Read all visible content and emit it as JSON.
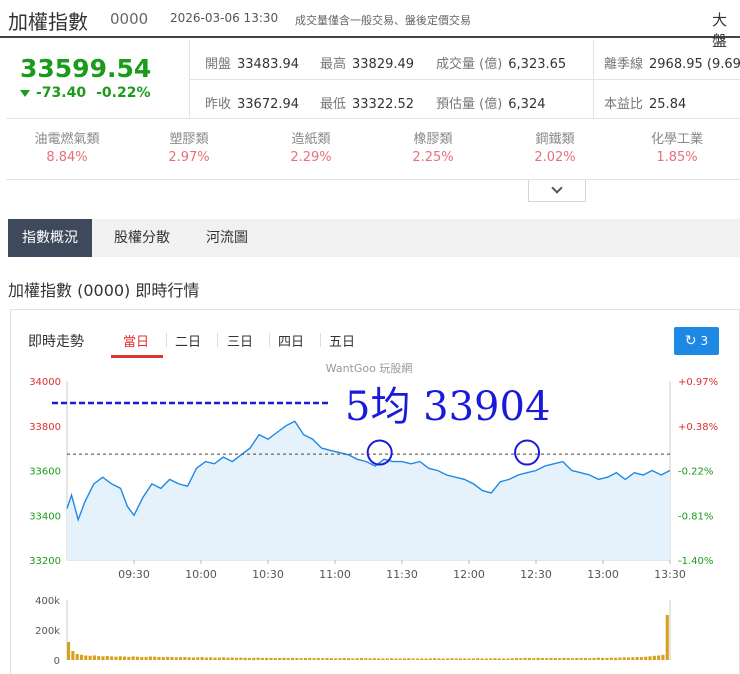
{
  "header": {
    "title": "加權指數",
    "code": "0000",
    "datetime": "2026-03-06 13:30",
    "note": "成交量僅含一般交易、盤後定價交易",
    "market": "大盤"
  },
  "quote": {
    "price": "33599.54",
    "change": "-73.40",
    "change_pct": "-0.22%",
    "stats": [
      {
        "label": "開盤",
        "value": "33483.94"
      },
      {
        "label": "最高",
        "value": "33829.49"
      },
      {
        "label": "成交量 (億)",
        "value": "6,323.65"
      },
      {
        "label": "離季線",
        "value": "2968.95 (9.69"
      },
      {
        "label": "昨收",
        "value": "33672.94"
      },
      {
        "label": "最低",
        "value": "33322.52"
      },
      {
        "label": "預估量 (億)",
        "value": "6,324"
      },
      {
        "label": "本益比",
        "value": "25.84"
      }
    ]
  },
  "sectors": [
    {
      "name": "油電燃氣類",
      "pct": "8.84%"
    },
    {
      "name": "塑膠類",
      "pct": "2.97%"
    },
    {
      "name": "造紙類",
      "pct": "2.29%"
    },
    {
      "name": "橡膠類",
      "pct": "2.25%"
    },
    {
      "name": "鋼鐵類",
      "pct": "2.02%"
    },
    {
      "name": "化學工業",
      "pct": "1.85%"
    }
  ],
  "nav": {
    "tabs": [
      "指數概況",
      "股權分散",
      "河流圖"
    ],
    "active": 0
  },
  "section_title": "加權指數 (0000) 即時行情",
  "chart_panel": {
    "title": "即時走勢",
    "tabs": [
      "當日",
      "二日",
      "三日",
      "四日",
      "五日"
    ],
    "active_tab": 0,
    "refresh_label": "3",
    "refresh_icon": "refresh-icon",
    "watermark": "WantGoo 玩股網",
    "annotation": "5均 33904"
  },
  "chart_data": {
    "type": "area",
    "prev_close": 33672.94,
    "ylim": [
      33200,
      34000
    ],
    "left_ticks": [
      "34000",
      "33800",
      "33600",
      "33400",
      "33200"
    ],
    "right_ticks": [
      "+0.97%",
      "+0.38%",
      "-0.22%",
      "-0.81%",
      "-1.40%"
    ],
    "x_ticks": [
      "09:30",
      "10:00",
      "10:30",
      "11:00",
      "11:30",
      "12:00",
      "12:30",
      "13:00",
      "13:30"
    ],
    "x_range_minutes": [
      0,
      270
    ],
    "price_points": [
      [
        0,
        33430
      ],
      [
        2,
        33490
      ],
      [
        5,
        33380
      ],
      [
        8,
        33460
      ],
      [
        12,
        33540
      ],
      [
        16,
        33570
      ],
      [
        20,
        33540
      ],
      [
        24,
        33520
      ],
      [
        27,
        33440
      ],
      [
        30,
        33400
      ],
      [
        34,
        33480
      ],
      [
        38,
        33540
      ],
      [
        42,
        33520
      ],
      [
        46,
        33560
      ],
      [
        50,
        33540
      ],
      [
        54,
        33530
      ],
      [
        58,
        33610
      ],
      [
        62,
        33640
      ],
      [
        66,
        33630
      ],
      [
        70,
        33660
      ],
      [
        74,
        33640
      ],
      [
        78,
        33670
      ],
      [
        82,
        33700
      ],
      [
        86,
        33760
      ],
      [
        90,
        33740
      ],
      [
        94,
        33770
      ],
      [
        98,
        33800
      ],
      [
        102,
        33820
      ],
      [
        106,
        33760
      ],
      [
        110,
        33740
      ],
      [
        114,
        33700
      ],
      [
        118,
        33690
      ],
      [
        122,
        33680
      ],
      [
        126,
        33670
      ],
      [
        130,
        33650
      ],
      [
        134,
        33640
      ],
      [
        138,
        33620
      ],
      [
        142,
        33650
      ],
      [
        146,
        33640
      ],
      [
        150,
        33640
      ],
      [
        154,
        33630
      ],
      [
        158,
        33640
      ],
      [
        162,
        33610
      ],
      [
        166,
        33600
      ],
      [
        170,
        33580
      ],
      [
        174,
        33570
      ],
      [
        178,
        33560
      ],
      [
        182,
        33540
      ],
      [
        186,
        33510
      ],
      [
        190,
        33500
      ],
      [
        194,
        33550
      ],
      [
        198,
        33560
      ],
      [
        202,
        33580
      ],
      [
        206,
        33590
      ],
      [
        210,
        33600
      ],
      [
        214,
        33620
      ],
      [
        218,
        33630
      ],
      [
        222,
        33640
      ],
      [
        226,
        33600
      ],
      [
        230,
        33590
      ],
      [
        234,
        33580
      ],
      [
        238,
        33560
      ],
      [
        242,
        33570
      ],
      [
        246,
        33590
      ],
      [
        250,
        33560
      ],
      [
        254,
        33590
      ],
      [
        258,
        33580
      ],
      [
        262,
        33600
      ],
      [
        266,
        33580
      ],
      [
        270,
        33600
      ]
    ],
    "ma_line": {
      "label": "5均",
      "value": 33904
    },
    "highlights": [
      {
        "x": 140,
        "y": 33640
      },
      {
        "x": 206,
        "y": 33640
      }
    ],
    "volume": {
      "ylim": [
        0,
        400000
      ],
      "ticks": [
        "400k",
        "200k",
        "0"
      ],
      "bars": [
        120000,
        60000,
        40000,
        35000,
        30000,
        28000,
        30000,
        26000,
        25000,
        27000,
        24000,
        22000,
        25000,
        23000,
        21000,
        24000,
        22000,
        20000,
        21000,
        23000,
        22000,
        20000,
        19000,
        21000,
        20000,
        18000,
        19000,
        20000,
        18000,
        17000,
        18000,
        19000,
        17000,
        18000,
        16000,
        17000,
        18000,
        16000,
        17000,
        15000,
        16000,
        15000,
        14000,
        15000,
        16000,
        14000,
        15000,
        14000,
        13000,
        14000,
        15000,
        13000,
        14000,
        13000,
        12000,
        13000,
        14000,
        12000,
        13000,
        12000,
        13000,
        12000,
        11000,
        12000,
        13000,
        12000,
        11000,
        12000,
        13000,
        12000,
        11000,
        12000,
        11000,
        10000,
        11000,
        12000,
        11000,
        10000,
        11000,
        12000,
        11000,
        10000,
        11000,
        10000,
        11000,
        12000,
        11000,
        10000,
        11000,
        12000,
        11000,
        10000,
        11000,
        10000,
        11000,
        12000,
        11000,
        10000,
        11000,
        12000,
        11000,
        10000,
        11000,
        12000,
        13000,
        12000,
        14000,
        13000,
        12000,
        15000,
        13000,
        12000,
        14000,
        13000,
        12000,
        14000,
        13000,
        12000,
        13000,
        14000,
        13000,
        12000,
        14000,
        16000,
        15000,
        14000,
        16000,
        15000,
        17000,
        18000,
        17000,
        18000,
        20000,
        19000,
        22000,
        25000,
        28000,
        30000,
        35000,
        300000
      ]
    }
  },
  "colors": {
    "up": "#e03030",
    "down": "#1a9b1a",
    "line": "#1e88e5",
    "area": "#e6f2fb",
    "annotation": "#1a1adb",
    "volume": "#d6a21e"
  }
}
